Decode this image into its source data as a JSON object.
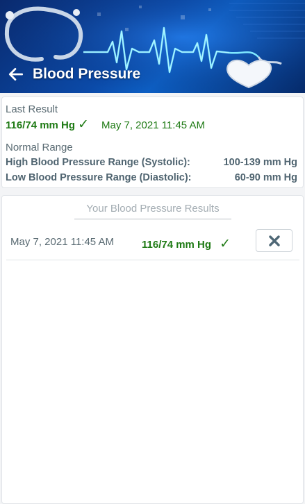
{
  "header": {
    "title": "Blood Pressure",
    "back_icon": "arrow-left-icon",
    "background_colors": [
      "#0a2a6e",
      "#0d5fc4"
    ]
  },
  "last_result": {
    "label": "Last Result",
    "value": "116/74 mm Hg",
    "status_icon": "checkmark-icon",
    "date": "May 7, 2021 11:45 AM",
    "value_color": "#1e7a14"
  },
  "normal_range": {
    "label": "Normal Range",
    "rows": [
      {
        "name": "High Blood Pressure Range (Systolic):",
        "value": "100-139 mm Hg"
      },
      {
        "name": "Low Blood Pressure Range (Diastolic):",
        "value": "60-90 mm Hg"
      }
    ]
  },
  "results": {
    "heading": "Your Blood Pressure Results",
    "items": [
      {
        "date": "May 7, 2021 11:45 AM",
        "value": "116/74 mm Hg",
        "status_icon": "checkmark-icon",
        "delete_icon": "close-x-icon"
      }
    ]
  }
}
